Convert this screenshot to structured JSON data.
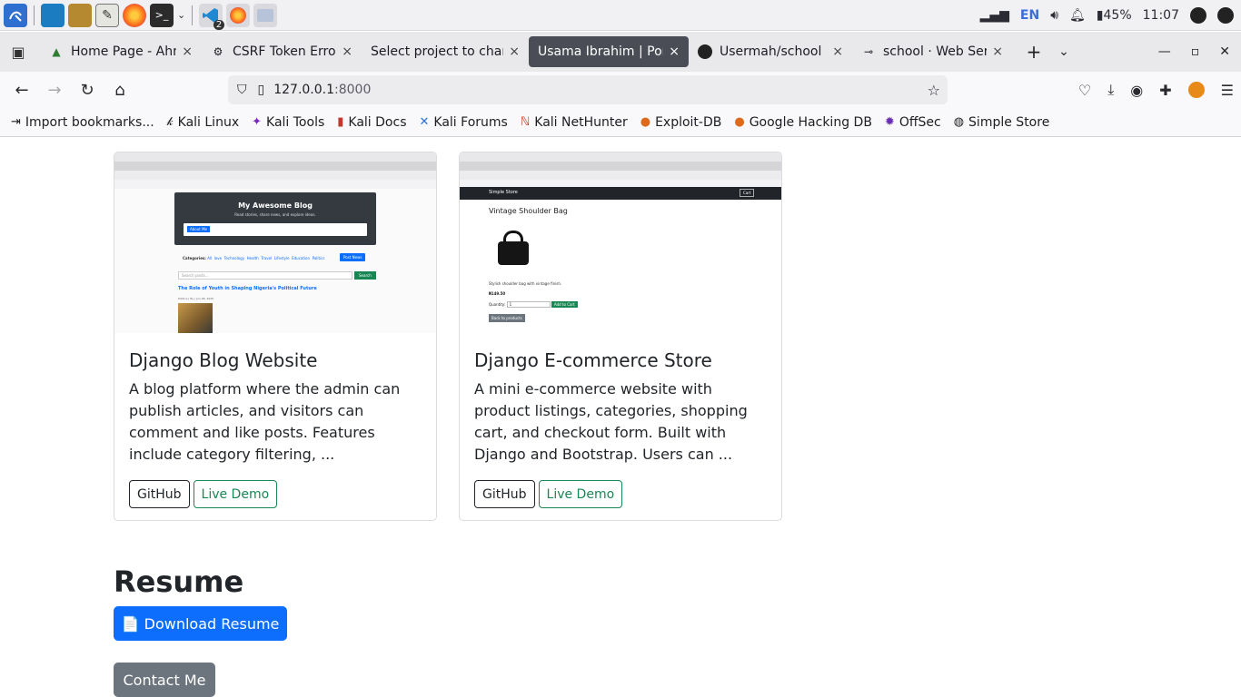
{
  "taskbar": {
    "battery": "45%",
    "time": "11:07",
    "lang": "EN",
    "vscode_badge": "2"
  },
  "tabs": [
    {
      "label": "Home Page - Ahmad",
      "icon": "leaf-icon",
      "active": false
    },
    {
      "label": "CSRF Token Error Fix",
      "icon": "openai-icon",
      "active": false
    },
    {
      "label": "Select project to change",
      "icon": "",
      "active": false
    },
    {
      "label": "Usama Ibrahim | Portfolio",
      "icon": "",
      "active": true
    },
    {
      "label": "Usermah/school",
      "icon": "github-icon",
      "active": false
    },
    {
      "label": "school · Web Service",
      "icon": "render-icon",
      "active": false
    }
  ],
  "tab_close": "×",
  "new_tab": "+",
  "url": {
    "host": "127.0.0.1",
    "port": ":8000"
  },
  "bookmarks": [
    {
      "label": "Import bookmarks...",
      "icon": "import-icon"
    },
    {
      "label": "Kali Linux",
      "icon": "kali-dragon-icon"
    },
    {
      "label": "Kali Tools",
      "icon": "kali-tools-icon"
    },
    {
      "label": "Kali Docs",
      "icon": "kali-docs-icon"
    },
    {
      "label": "Kali Forums",
      "icon": "kali-forums-icon"
    },
    {
      "label": "Kali NetHunter",
      "icon": "kali-nethunter-icon"
    },
    {
      "label": "Exploit-DB",
      "icon": "exploit-db-icon"
    },
    {
      "label": "Google Hacking DB",
      "icon": "ghdb-icon"
    },
    {
      "label": "OffSec",
      "icon": "offsec-icon"
    },
    {
      "label": "Simple Store",
      "icon": "globe-icon"
    }
  ],
  "projects": [
    {
      "title": "Django Blog Website",
      "description": "A blog platform where the admin can publish articles, and visitors can comment and like posts. Features include category filtering, ...",
      "github_label": "GitHub",
      "demo_label": "Live Demo",
      "shot": {
        "site_title": "My Awesome Blog",
        "site_sub": "Read stories, share news, and explore ideas.",
        "about_btn": "About Me",
        "categories_label": "Categories:",
        "categories": [
          "All",
          "love",
          "Technology",
          "Health",
          "Travel",
          "Lifestyle",
          "Education",
          "Politics"
        ],
        "post_btn": "Post News",
        "search_placeholder": "Search posts...",
        "search_btn": "Search",
        "post_title": "The Role of Youth in Shaping Nigeria's Political Future",
        "post_meta": "Politics | By | Jun 06, 2025"
      }
    },
    {
      "title": "Django E-commerce Store",
      "description": "A mini e-commerce website with product listings, categories, shopping cart, and checkout form. Built with Django and Bootstrap. Users can ...",
      "github_label": "GitHub",
      "demo_label": "Live Demo",
      "shot": {
        "store_name": "Simple Store",
        "cart_label": "Cart",
        "product_name": "Vintage Shoulder Bag",
        "product_desc": "Stylish shoulder bag with vintage finish.",
        "price": "₦149.50",
        "qty_label": "Quantity:",
        "qty_value": "1",
        "add_btn": "Add to Cart",
        "back_btn": "Back to products"
      }
    }
  ],
  "resume": {
    "heading": "Resume",
    "download_label": "📄 Download Resume",
    "contact_label": "Contact Me"
  },
  "colors": {
    "primary": "#0d6efd",
    "secondary": "#6c757d",
    "success": "#198754",
    "active_tab": "#4a4d55"
  }
}
